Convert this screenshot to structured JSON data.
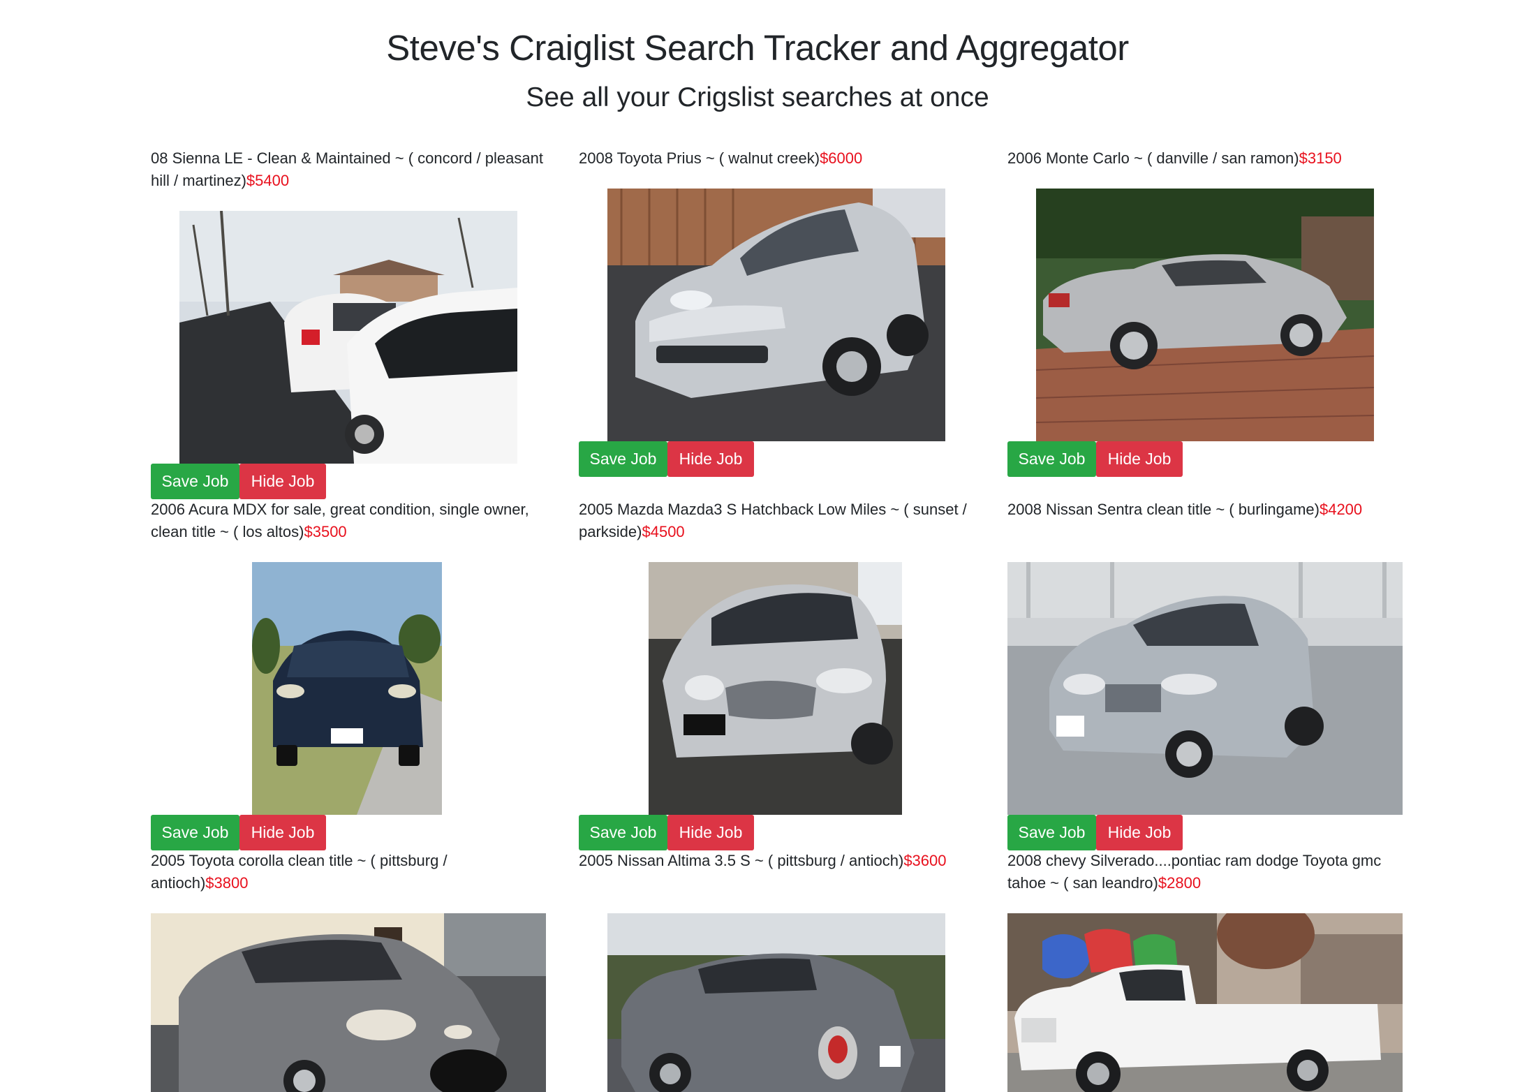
{
  "header": {
    "title": "Steve's Craiglist Search Tracker and Aggregator",
    "subtitle": "See all your Crigslist searches at once"
  },
  "buttons": {
    "save_label": "Save Job",
    "hide_label": "Hide Job"
  },
  "listings": [
    {
      "title": "08 Sienna LE - Clean & Maintained ~ ( concord / pleasant hill / martinez)",
      "price": "$5400"
    },
    {
      "title": "2008 Toyota Prius ~ ( walnut creek)",
      "price": "$6000"
    },
    {
      "title": "2006 Monte Carlo ~ ( danville / san ramon)",
      "price": "$3150"
    },
    {
      "title": "2006 Acura MDX for sale, great condition, single owner, clean title ~ ( los altos)",
      "price": "$3500"
    },
    {
      "title": "2005 Mazda Mazda3 S Hatchback Low Miles ~ ( sunset / parkside)",
      "price": "$4500"
    },
    {
      "title": "2008 Nissan Sentra clean title ~ ( burlingame)",
      "price": "$4200"
    },
    {
      "title": "2005 Toyota corolla clean title ~ ( pittsburg / antioch)",
      "price": "$3800"
    },
    {
      "title": "2005 Nissan Altima 3.5 S ~ ( pittsburg / antioch)",
      "price": "$3600"
    },
    {
      "title": "2008 chevy Silverado....pontiac ram dodge Toyota gmc tahoe ~ ( san leandro)",
      "price": "$2800"
    }
  ],
  "colors": {
    "price": "#e8101d",
    "save_button": "#28a745",
    "hide_button": "#dc3545"
  }
}
